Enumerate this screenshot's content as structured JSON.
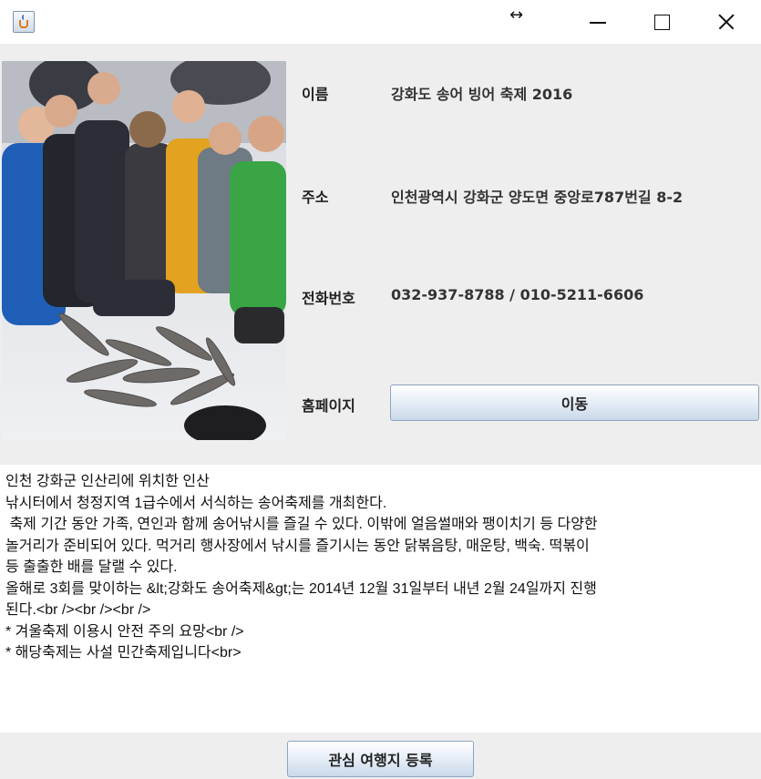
{
  "titlebar": {
    "app_icon": "java-cup-icon",
    "resize_icon": "resize-horizontal-icon",
    "resize_glyph": "↔",
    "buttons": [
      "minimize-icon",
      "maximize-icon",
      "close-icon"
    ]
  },
  "photo": {
    "subject": "Group of people on frozen river with caught fish"
  },
  "info": {
    "name_label": "이름",
    "name_value": "강화도 송어 빙어 축제 2016",
    "address_label": "주소",
    "address_value": "인천광역시 강화군 양도면 중앙로787번길 8-2",
    "phone_label": "전화번호",
    "phone_value": "032-937-8788 / 010-5211-6606",
    "homepage_label": "홈페이지",
    "go_button": "이동"
  },
  "description": {
    "lines": [
      "인천 강화군 인산리에 위치한 인산",
      "낚시터에서 청정지역 1급수에서 서식하는 송어축제를 개최한다.",
      " 축제 기간 동안 가족, 연인과 함께 송어낚시를 즐길 수 있다. 이밖에 얼음썰매와 팽이치기 등 다양한",
      "놀거리가 준비되어 있다. 먹거리 행사장에서 낚시를 즐기시는 동안 닭볶음탕, 매운탕, 백숙. 떡볶이",
      "등 출출한 배를 달랠 수 있다.",
      "올해로 3회를 맞이하는 &lt;강화도 송어축제&gt;는 2014년 12월 31일부터 내년 2월 24일까지 진행",
      "된다.<br /><br /><br />",
      "",
      "* 겨울축제 이용시 안전 주의 요망<br />",
      "* 해당축제는 사설 민간축제입니다<br>"
    ]
  },
  "footer": {
    "favorite_button": "관심 여행지 등록"
  },
  "colors": {
    "window_bg": "#eeeeee",
    "button_border": "#8ea4c0",
    "button_gradient_bottom": "#cad8e8"
  }
}
